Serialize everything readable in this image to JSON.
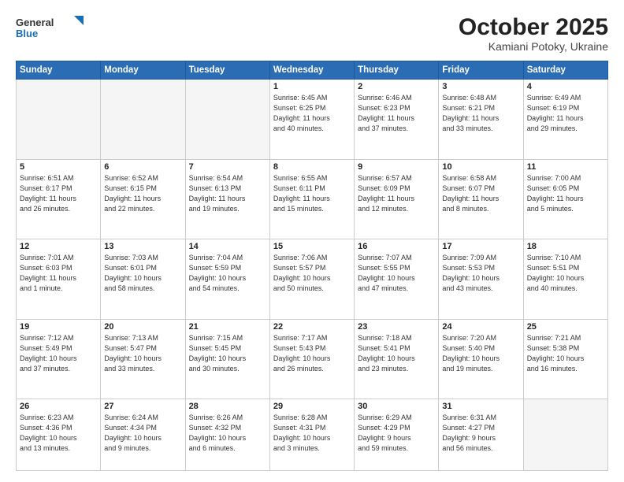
{
  "header": {
    "logo_general": "General",
    "logo_blue": "Blue",
    "title": "October 2025",
    "location": "Kamiani Potoky, Ukraine"
  },
  "weekdays": [
    "Sunday",
    "Monday",
    "Tuesday",
    "Wednesday",
    "Thursday",
    "Friday",
    "Saturday"
  ],
  "weeks": [
    [
      {
        "day": "",
        "info": ""
      },
      {
        "day": "",
        "info": ""
      },
      {
        "day": "",
        "info": ""
      },
      {
        "day": "1",
        "info": "Sunrise: 6:45 AM\nSunset: 6:25 PM\nDaylight: 11 hours\nand 40 minutes."
      },
      {
        "day": "2",
        "info": "Sunrise: 6:46 AM\nSunset: 6:23 PM\nDaylight: 11 hours\nand 37 minutes."
      },
      {
        "day": "3",
        "info": "Sunrise: 6:48 AM\nSunset: 6:21 PM\nDaylight: 11 hours\nand 33 minutes."
      },
      {
        "day": "4",
        "info": "Sunrise: 6:49 AM\nSunset: 6:19 PM\nDaylight: 11 hours\nand 29 minutes."
      }
    ],
    [
      {
        "day": "5",
        "info": "Sunrise: 6:51 AM\nSunset: 6:17 PM\nDaylight: 11 hours\nand 26 minutes."
      },
      {
        "day": "6",
        "info": "Sunrise: 6:52 AM\nSunset: 6:15 PM\nDaylight: 11 hours\nand 22 minutes."
      },
      {
        "day": "7",
        "info": "Sunrise: 6:54 AM\nSunset: 6:13 PM\nDaylight: 11 hours\nand 19 minutes."
      },
      {
        "day": "8",
        "info": "Sunrise: 6:55 AM\nSunset: 6:11 PM\nDaylight: 11 hours\nand 15 minutes."
      },
      {
        "day": "9",
        "info": "Sunrise: 6:57 AM\nSunset: 6:09 PM\nDaylight: 11 hours\nand 12 minutes."
      },
      {
        "day": "10",
        "info": "Sunrise: 6:58 AM\nSunset: 6:07 PM\nDaylight: 11 hours\nand 8 minutes."
      },
      {
        "day": "11",
        "info": "Sunrise: 7:00 AM\nSunset: 6:05 PM\nDaylight: 11 hours\nand 5 minutes."
      }
    ],
    [
      {
        "day": "12",
        "info": "Sunrise: 7:01 AM\nSunset: 6:03 PM\nDaylight: 11 hours\nand 1 minute."
      },
      {
        "day": "13",
        "info": "Sunrise: 7:03 AM\nSunset: 6:01 PM\nDaylight: 10 hours\nand 58 minutes."
      },
      {
        "day": "14",
        "info": "Sunrise: 7:04 AM\nSunset: 5:59 PM\nDaylight: 10 hours\nand 54 minutes."
      },
      {
        "day": "15",
        "info": "Sunrise: 7:06 AM\nSunset: 5:57 PM\nDaylight: 10 hours\nand 50 minutes."
      },
      {
        "day": "16",
        "info": "Sunrise: 7:07 AM\nSunset: 5:55 PM\nDaylight: 10 hours\nand 47 minutes."
      },
      {
        "day": "17",
        "info": "Sunrise: 7:09 AM\nSunset: 5:53 PM\nDaylight: 10 hours\nand 43 minutes."
      },
      {
        "day": "18",
        "info": "Sunrise: 7:10 AM\nSunset: 5:51 PM\nDaylight: 10 hours\nand 40 minutes."
      }
    ],
    [
      {
        "day": "19",
        "info": "Sunrise: 7:12 AM\nSunset: 5:49 PM\nDaylight: 10 hours\nand 37 minutes."
      },
      {
        "day": "20",
        "info": "Sunrise: 7:13 AM\nSunset: 5:47 PM\nDaylight: 10 hours\nand 33 minutes."
      },
      {
        "day": "21",
        "info": "Sunrise: 7:15 AM\nSunset: 5:45 PM\nDaylight: 10 hours\nand 30 minutes."
      },
      {
        "day": "22",
        "info": "Sunrise: 7:17 AM\nSunset: 5:43 PM\nDaylight: 10 hours\nand 26 minutes."
      },
      {
        "day": "23",
        "info": "Sunrise: 7:18 AM\nSunset: 5:41 PM\nDaylight: 10 hours\nand 23 minutes."
      },
      {
        "day": "24",
        "info": "Sunrise: 7:20 AM\nSunset: 5:40 PM\nDaylight: 10 hours\nand 19 minutes."
      },
      {
        "day": "25",
        "info": "Sunrise: 7:21 AM\nSunset: 5:38 PM\nDaylight: 10 hours\nand 16 minutes."
      }
    ],
    [
      {
        "day": "26",
        "info": "Sunrise: 6:23 AM\nSunset: 4:36 PM\nDaylight: 10 hours\nand 13 minutes."
      },
      {
        "day": "27",
        "info": "Sunrise: 6:24 AM\nSunset: 4:34 PM\nDaylight: 10 hours\nand 9 minutes."
      },
      {
        "day": "28",
        "info": "Sunrise: 6:26 AM\nSunset: 4:32 PM\nDaylight: 10 hours\nand 6 minutes."
      },
      {
        "day": "29",
        "info": "Sunrise: 6:28 AM\nSunset: 4:31 PM\nDaylight: 10 hours\nand 3 minutes."
      },
      {
        "day": "30",
        "info": "Sunrise: 6:29 AM\nSunset: 4:29 PM\nDaylight: 9 hours\nand 59 minutes."
      },
      {
        "day": "31",
        "info": "Sunrise: 6:31 AM\nSunset: 4:27 PM\nDaylight: 9 hours\nand 56 minutes."
      },
      {
        "day": "",
        "info": ""
      }
    ]
  ]
}
